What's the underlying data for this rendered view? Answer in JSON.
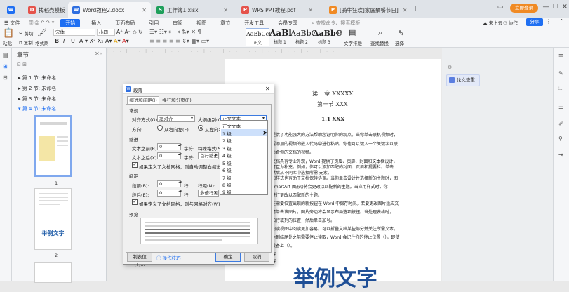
{
  "tabs": [
    {
      "label": "找稻壳模板",
      "color": "#e5534b"
    },
    {
      "label": "Word教程2.docx",
      "color": "#2f6fe0"
    },
    {
      "label": "工作簿1.xlsx",
      "color": "#1e9f5b"
    },
    {
      "label": "WPS PPT教程.pdf",
      "color": "#e5534b"
    },
    {
      "label": "[骑牛狂欢]家庭聚餐节日]",
      "color": "#f08a24"
    }
  ],
  "account": {
    "login": "立即登录"
  },
  "menu": {
    "file": "文件",
    "items": [
      "开始",
      "插入",
      "页面布局",
      "引用",
      "审阅",
      "视图",
      "章节",
      "开发工具",
      "会员专享"
    ],
    "search": "查找命令、搜索模板",
    "cloud": "未上云",
    "collab": "协作",
    "share": "分享"
  },
  "ribbon": {
    "paste": "粘贴",
    "cut": "剪切",
    "copy": "复制",
    "format_painter": "格式刷",
    "font": "宋体",
    "size": "小四",
    "styles": [
      {
        "preview": "AaBbCcI",
        "label": "正文"
      },
      {
        "preview": "AaBl",
        "label": "标题 1"
      },
      {
        "preview": "AaBbC",
        "label": "标题 2"
      },
      {
        "preview": "AaBbC",
        "label": "标题 3"
      }
    ],
    "text_layout": "文字排版",
    "find_replace": "查找替换",
    "select": "选择"
  },
  "nav": {
    "title": "章节",
    "chapters": [
      "第 1 节: 未命名",
      "第 2 节: 未命名",
      "第 3 节: 未命名",
      "第 4 节: 未命名"
    ],
    "page_numbers": [
      "1",
      "2"
    ],
    "thumb_text": "举例文字"
  },
  "document": {
    "chapter": "第一章 XXXXX",
    "section": "第一节 XXX",
    "subsection": "1.1 XXX",
    "lines": [
      "提供了功能强大的方法帮助您证明你的观点。当你单击联机视频时，",
      "要添加的视频的嵌入代码中进行粘贴。你也可以键入一个关键字以联",
      "适合你的文档的视频。",
      "文档具有专业外观，Word 提供了页眉、页脚、封面和文本框设计，",
      "可互为补充。例如，你可以添加匹配的封面、页眉和提要栏。单击",
      "然后从不同库中选择所需 元素。",
      "和样式也有助于文档保持协调。当你单击设计并选择新的主题时，图",
      "SmartArt 图形()将会更改以匹配新的主题。当应用样式时，你",
      "进行更改以匹配新的主题。",
      "在需要位置出现的新按钮在 Word 中保存时间。若要更改图片适应文",
      "请单击该图片，图片旁边将会显示布局选项按钮。当处理表格时，",
      "加行或列的位置，然后单击加号。",
      "阅读视图中阅读更加容易。可以折叠文档某些部分并关注所需文本。",
      "达到结尾处之前需要停止读取，Word 会记住你的停止位置（），即使",
      "设备上（）。",
      "容",
      "容"
    ],
    "big_text": "举例文字"
  },
  "right_panel": {
    "essay_check": "论文查重"
  },
  "dialog": {
    "title": "段落",
    "tabs": [
      "缩进和间距(I)",
      "换行和分页(P)"
    ],
    "general": "常规",
    "alignment_label": "对齐方式(G):",
    "alignment_value": "左对齐",
    "outline_label": "大纲级别(O):",
    "outline_value": "正文文本",
    "direction_label": "方向:",
    "rtl": "从右向左(F)",
    "ltr": "从左向右",
    "indent": "缩进",
    "before_text": "文本之前(R):",
    "after_text": "文本之后(X):",
    "indent_value": "0",
    "unit_char": "字符·",
    "special_format": "特殊格式(S):",
    "hanging": "首行缩进",
    "auto_right_indent": "如果定义了文档网格，则自动调整右缩进(D)",
    "spacing": "间距",
    "before": "段前(B):",
    "after": "段后(E):",
    "spacing_value": "0",
    "unit_line": "行·",
    "line_spacing": "行距(N):",
    "multiple": "多倍行距",
    "snap_grid": "如果定义了文档网格，则与网格对齐(W)",
    "preview": "预览",
    "tabs_button": "制表位(T)...",
    "tips": "操作技巧",
    "ok": "确定",
    "cancel": "取消",
    "outline_options": [
      "正文文本",
      "1 级",
      "2 级",
      "3 级",
      "4 级",
      "5 级",
      "6 级",
      "7 级",
      "8 级",
      "9 级"
    ]
  }
}
